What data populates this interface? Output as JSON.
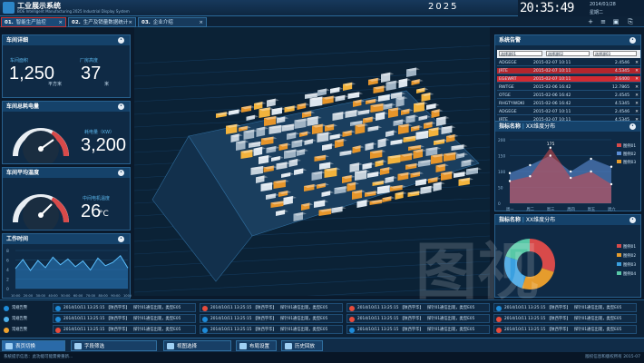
{
  "app": {
    "title": "工业展示系统",
    "subtitle": "BOE Intelligent Manufacturing 2025 Industrial Display System",
    "year": "2025",
    "clock": "20:35:49",
    "date": "2014/01/28",
    "weekday": "星期二"
  },
  "window_buttons": [
    "+",
    "—",
    "▭",
    "✕"
  ],
  "tabs": [
    {
      "num": "01.",
      "label": "智能生产监控",
      "active": true
    },
    {
      "num": "02.",
      "label": "生产及销量数据统计",
      "active": false
    },
    {
      "num": "03.",
      "label": "企业介绍",
      "active": false
    }
  ],
  "toolbar": {
    "add": "+",
    "menu": "≡",
    "copy": "▣"
  },
  "workshop": {
    "title": "车间详细",
    "area_label": "车间面积",
    "area_value": "1,250",
    "area_unit": "平方米",
    "height_label": "厂房高度",
    "height_value": "37",
    "height_unit": "米"
  },
  "power": {
    "title": "车间总耗电量",
    "label": "耗电量（KW）",
    "value": "3,200",
    "gauge_level": 0.72
  },
  "temperature": {
    "title": "车间平均温度",
    "label": "中间电机温度",
    "value": "26",
    "unit": "°C",
    "gauge_level": 0.55
  },
  "worktime": {
    "title": "工作时间",
    "ylabels": [
      "8",
      "6",
      "4",
      "2",
      "0"
    ],
    "xlabels": [
      "10:00",
      "20:00",
      "30:00",
      "40:00",
      "50:00",
      "60:00",
      "70:00",
      "80:00",
      "90:00",
      "100:00"
    ],
    "values": [
      4.2,
      6.1,
      3.8,
      5.9,
      4.4,
      6.6,
      5.0,
      6.2,
      4.6,
      5.8,
      3.9,
      6.4,
      4.8,
      5.5,
      6.9,
      4.3
    ]
  },
  "alarms": {
    "title": "系统告警",
    "col1": "选择源01",
    "col2": "选择源02",
    "col3": "选择源03",
    "rows": [
      {
        "name": "ADGEGE",
        "time": "2015-02-07 10:11",
        "value": "2.4546",
        "hl": "none"
      },
      {
        "name": "JRTE",
        "time": "2015-02-07 10:11",
        "value": "4.5345",
        "hl": "red"
      },
      {
        "name": "EGEWRT",
        "time": "2015-02-07 10:11",
        "value": "3.6400",
        "hl": "red2"
      },
      {
        "name": "RWTGE",
        "time": "2015-02-06 16:42",
        "value": "12.7865",
        "hl": "none"
      },
      {
        "name": "OTGE",
        "time": "2015-02-06 16:42",
        "value": "2.4545",
        "hl": "none"
      },
      {
        "name": "RHGTYWDKI",
        "time": "2015-02-06 16:42",
        "value": "4.5345",
        "hl": "none"
      },
      {
        "name": "ADGEGE",
        "time": "2015-02-07 10:11",
        "value": "2.4546",
        "hl": "none"
      },
      {
        "name": "JRTE",
        "time": "2015-02-07 10:11",
        "value": "4.5345",
        "hl": "none"
      }
    ]
  },
  "metric1": {
    "title": "指标名称",
    "subtitle": "XX维度分布",
    "peak_label": "175",
    "yticks": [
      "200",
      "150",
      "100",
      "50",
      "0"
    ],
    "xticks": [
      "周一",
      "周二",
      "周三",
      "周四",
      "周五",
      "周六"
    ],
    "series1": [
      95,
      120,
      150,
      100,
      140,
      115
    ],
    "series2": [
      70,
      85,
      175,
      80,
      100,
      60
    ],
    "legend": [
      "图例01",
      "图例02",
      "图例03"
    ],
    "legend_colors": [
      "#d84a4a",
      "#5b8ed6",
      "#e59c2d"
    ]
  },
  "metric2": {
    "title": "指标名称",
    "subtitle": "XX维度分布",
    "legend": [
      "图例01",
      "图例02",
      "图例03",
      "图例04"
    ],
    "legend_colors": [
      "#d84a4a",
      "#e59c2d",
      "#3aa0e0",
      "#58c8a6"
    ],
    "values": [
      30,
      25,
      25,
      20
    ]
  },
  "events": [
    {
      "status": "常规告警",
      "color": "#1e8bd8",
      "type": "none"
    },
    {
      "status": "常规告警",
      "color": "#4fb0ea",
      "type": "none"
    },
    {
      "status": "常规告警",
      "color": "#f1a22d",
      "type": "none"
    }
  ],
  "event_entries": [
    {
      "time": "2014/10/11 13:25:15",
      "source": "【陕西宇华】",
      "msg": "探针01通信出现，类型E05",
      "color": "#1e8bd8"
    },
    {
      "time": "2014/10/11 13:25:15",
      "source": "【陕西宇华】",
      "msg": "探针01通信出现，类型E05",
      "color": "#1e8bd8"
    },
    {
      "time": "2014/10/11 13:25:15",
      "source": "【陕西宇华】",
      "msg": "探针01通信出现，类型E05",
      "color": "#e74c3c"
    },
    {
      "time": "2014/10/11 13:25:15",
      "source": "【陕西宇华】",
      "msg": "探针01通信出现，类型E05",
      "color": "#e74c3c"
    },
    {
      "time": "2014/10/11 13:25:15",
      "source": "【陕西宇华】",
      "msg": "探针01通信出现，类型E05",
      "color": "#1e8bd8"
    },
    {
      "time": "2014/10/11 13:25:15",
      "source": "【陕西宇华】",
      "msg": "探针01通信出现，类型E05",
      "color": "#1e8bd8"
    },
    {
      "time": "2014/10/11 13:25:15",
      "source": "【陕西宇华】",
      "msg": "探针01通信出现，类型E05",
      "color": "#e74c3c"
    },
    {
      "time": "2014/10/11 13:25:15",
      "source": "【陕西宇华】",
      "msg": "探针01通信出现，类型E05",
      "color": "#e74c3c"
    },
    {
      "time": "2014/10/11 13:25:15",
      "source": "【陕西宇华】",
      "msg": "探针01通信出现，类型E05",
      "color": "#1e8bd8"
    },
    {
      "time": "2014/10/11 13:25:15",
      "source": "【陕西宇华】",
      "msg": "探针01通信出现，类型E05",
      "color": "#1e8bd8"
    },
    {
      "time": "2014/10/11 13:25:15",
      "source": "【陕西宇华】",
      "msg": "探针01通信出现，类型E05",
      "color": "#e74c3c"
    },
    {
      "time": "2014/10/11 13:25:15",
      "source": "【陕西宇华】",
      "msg": "探针01通信出现，类型E05",
      "color": "#e74c3c"
    }
  ],
  "taskbar": [
    {
      "label": "表页切换",
      "active": true
    },
    {
      "label": "字段筛选",
      "active": false
    },
    {
      "label": "视图选择",
      "active": false
    },
    {
      "label": "布局设置",
      "active": false
    },
    {
      "label": "历史回放",
      "active": false
    }
  ],
  "statusbar": {
    "left": "系统提示信息：此功能可能需要重新...",
    "right": "版权信息和版权所有 2015-07"
  },
  "watermark": "图视"
}
